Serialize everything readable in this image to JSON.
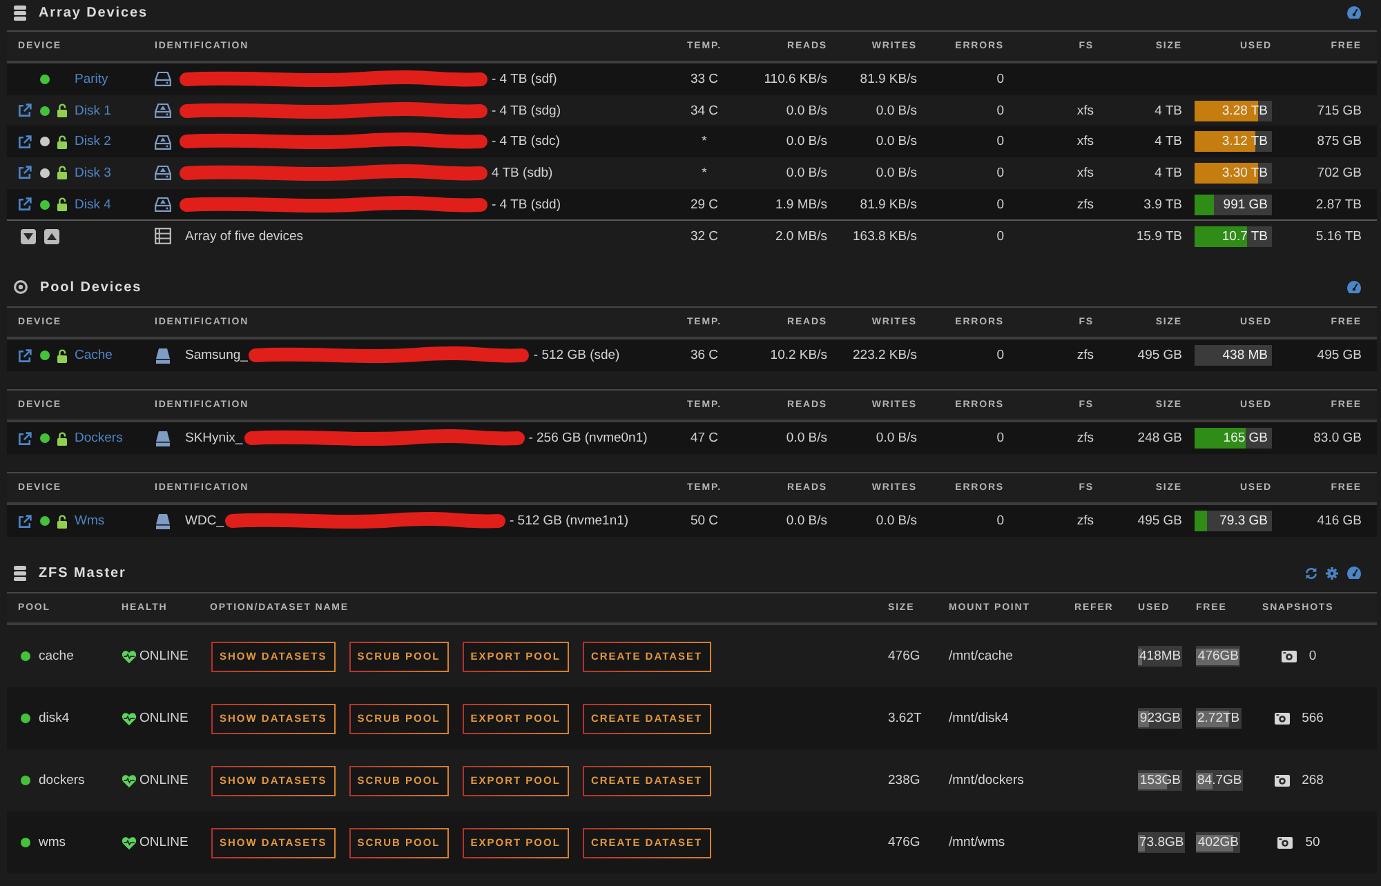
{
  "array_devices": {
    "title": "Array Devices",
    "columns": [
      "DEVICE",
      "IDENTIFICATION",
      "TEMP.",
      "READS",
      "WRITES",
      "ERRORS",
      "FS",
      "SIZE",
      "USED",
      "FREE"
    ],
    "rows": [
      {
        "kind": "parity",
        "name": "Parity",
        "color": "#44c23a",
        "identification": {
          "redacted": true,
          "after": "- 4 TB (sdf)"
        },
        "temp": "33 C",
        "reads": "110.6 KB/s",
        "writes": "81.9 KB/s",
        "errors": "0"
      },
      {
        "kind": "data",
        "name": "Disk 1",
        "color": "#44c23a",
        "identification": {
          "redacted": true,
          "after": "- 4 TB (sdg)"
        },
        "temp": "34 C",
        "reads": "0.0 B/s",
        "writes": "0.0 B/s",
        "errors": "0",
        "fs": "xfs",
        "size": "4 TB",
        "used": {
          "text": "3.28 TB",
          "level": 0.82,
          "color": "#c47d0e"
        },
        "free": "715 GB"
      },
      {
        "kind": "data",
        "name": "Disk 2",
        "color": "#c9c9c9",
        "identification": {
          "redacted": true,
          "after": "- 4 TB (sdc)"
        },
        "temp": "*",
        "reads": "0.0 B/s",
        "writes": "0.0 B/s",
        "errors": "0",
        "fs": "xfs",
        "size": "4 TB",
        "used": {
          "text": "3.12 TB",
          "level": 0.78,
          "color": "#c47d0e"
        },
        "free": "875 GB"
      },
      {
        "kind": "data",
        "name": "Disk 3",
        "color": "#c9c9c9",
        "identification": {
          "redacted": true,
          "after": "4 TB (sdb)"
        },
        "temp": "*",
        "reads": "0.0 B/s",
        "writes": "0.0 B/s",
        "errors": "0",
        "fs": "xfs",
        "size": "4 TB",
        "used": {
          "text": "3.30 TB",
          "level": 0.82,
          "color": "#c47d0e"
        },
        "free": "702 GB"
      },
      {
        "kind": "data",
        "name": "Disk 4",
        "color": "#44c23a",
        "identification": {
          "redacted": true,
          "after": "- 4 TB (sdd)"
        },
        "temp": "29 C",
        "reads": "1.9 MB/s",
        "writes": "81.9 KB/s",
        "errors": "0",
        "fs": "zfs",
        "size": "3.9 TB",
        "used": {
          "text": "991 GB",
          "level": 0.25,
          "color": "#2f8c17"
        },
        "free": "2.87 TB"
      }
    ],
    "summary": {
      "label": "Array of five devices",
      "temp": "32 C",
      "reads": "2.0 MB/s",
      "writes": "163.8 KB/s",
      "errors": "0",
      "size": "15.9 TB",
      "used": {
        "text": "10.7 TB",
        "level": 0.67,
        "color": "#2f8c17"
      },
      "free": "5.16 TB"
    }
  },
  "pool_devices": {
    "title": "Pool Devices",
    "tables": [
      {
        "columns": [
          "DEVICE",
          "IDENTIFICATION",
          "TEMP.",
          "READS",
          "WRITES",
          "ERRORS",
          "FS",
          "SIZE",
          "USED",
          "FREE"
        ],
        "rows": [
          {
            "kind": "pool",
            "name": "Cache",
            "color": "#44c23a",
            "identification": {
              "before": "Samsung_",
              "redacted": true,
              "after": "- 512 GB (sde)"
            },
            "temp": "36 C",
            "reads": "10.2 KB/s",
            "writes": "223.2 KB/s",
            "errors": "0",
            "fs": "zfs",
            "size": "495 GB",
            "used": {
              "text": "438 MB",
              "level": 0
            },
            "free": "495 GB"
          }
        ]
      },
      {
        "columns": [
          "DEVICE",
          "IDENTIFICATION",
          "TEMP.",
          "READS",
          "WRITES",
          "ERRORS",
          "FS",
          "SIZE",
          "USED",
          "FREE"
        ],
        "rows": [
          {
            "kind": "pool",
            "name": "Dockers",
            "color": "#44c23a",
            "identification": {
              "before": "SKHynix_",
              "redacted": true,
              "after": "- 256 GB (nvme0n1)"
            },
            "temp": "47 C",
            "reads": "0.0 B/s",
            "writes": "0.0 B/s",
            "errors": "0",
            "fs": "zfs",
            "size": "248 GB",
            "used": {
              "text": "165 GB",
              "level": 0.66,
              "color": "#2f8c17"
            },
            "free": "83.0 GB"
          }
        ]
      },
      {
        "columns": [
          "DEVICE",
          "IDENTIFICATION",
          "TEMP.",
          "READS",
          "WRITES",
          "ERRORS",
          "FS",
          "SIZE",
          "USED",
          "FREE"
        ],
        "rows": [
          {
            "kind": "pool",
            "name": "Wms",
            "color": "#44c23a",
            "identification": {
              "before": "WDC_",
              "redacted": true,
              "after": "- 512 GB (nvme1n1)"
            },
            "temp": "50 C",
            "reads": "0.0 B/s",
            "writes": "0.0 B/s",
            "errors": "0",
            "fs": "zfs",
            "size": "495 GB",
            "used": {
              "text": "79.3 GB",
              "level": 0.16,
              "color": "#2f8c17"
            },
            "free": "416 GB"
          }
        ]
      }
    ]
  },
  "zfs_master": {
    "title": "ZFS Master",
    "columns": [
      "POOL",
      "HEALTH",
      "OPTION/DATASET NAME",
      "SIZE",
      "MOUNT POINT",
      "REFER",
      "USED",
      "FREE",
      "SNAPSHOTS"
    ],
    "pools": [
      {
        "name": "cache",
        "color": "#44c23a",
        "health": "ONLINE",
        "actions": [
          "SHOW DATASETS",
          "SCRUB POOL",
          "EXPORT POOL",
          "CREATE DATASET"
        ],
        "size": "476G",
        "mount_point": "/mnt/cache",
        "used": {
          "text": "418MB",
          "level": 0.08
        },
        "free": {
          "text": "476GB",
          "level": 0.97
        },
        "snapshots": "0"
      },
      {
        "name": "disk4",
        "color": "#44c23a",
        "health": "ONLINE",
        "actions": [
          "SHOW DATASETS",
          "SCRUB POOL",
          "EXPORT POOL",
          "CREATE DATASET"
        ],
        "size": "3.62T",
        "mount_point": "/mnt/disk4",
        "used": {
          "text": "923GB",
          "level": 0.25
        },
        "free": {
          "text": "2.72TB",
          "level": 0.75
        },
        "snapshots": "566"
      },
      {
        "name": "dockers",
        "color": "#44c23a",
        "health": "ONLINE",
        "actions": [
          "SHOW DATASETS",
          "SCRUB POOL",
          "EXPORT POOL",
          "CREATE DATASET"
        ],
        "size": "238G",
        "mount_point": "/mnt/dockers",
        "used": {
          "text": "153GB",
          "level": 0.66
        },
        "free": {
          "text": "84.7GB",
          "level": 0.36
        },
        "snapshots": "268"
      },
      {
        "name": "wms",
        "color": "#44c23a",
        "health": "ONLINE",
        "actions": [
          "SHOW DATASETS",
          "SCRUB POOL",
          "EXPORT POOL",
          "CREATE DATASET"
        ],
        "size": "476G",
        "mount_point": "/mnt/wms",
        "used": {
          "text": "73.8GB",
          "level": 0.16
        },
        "free": {
          "text": "402GB",
          "level": 0.85
        },
        "snapshots": "50"
      }
    ]
  }
}
